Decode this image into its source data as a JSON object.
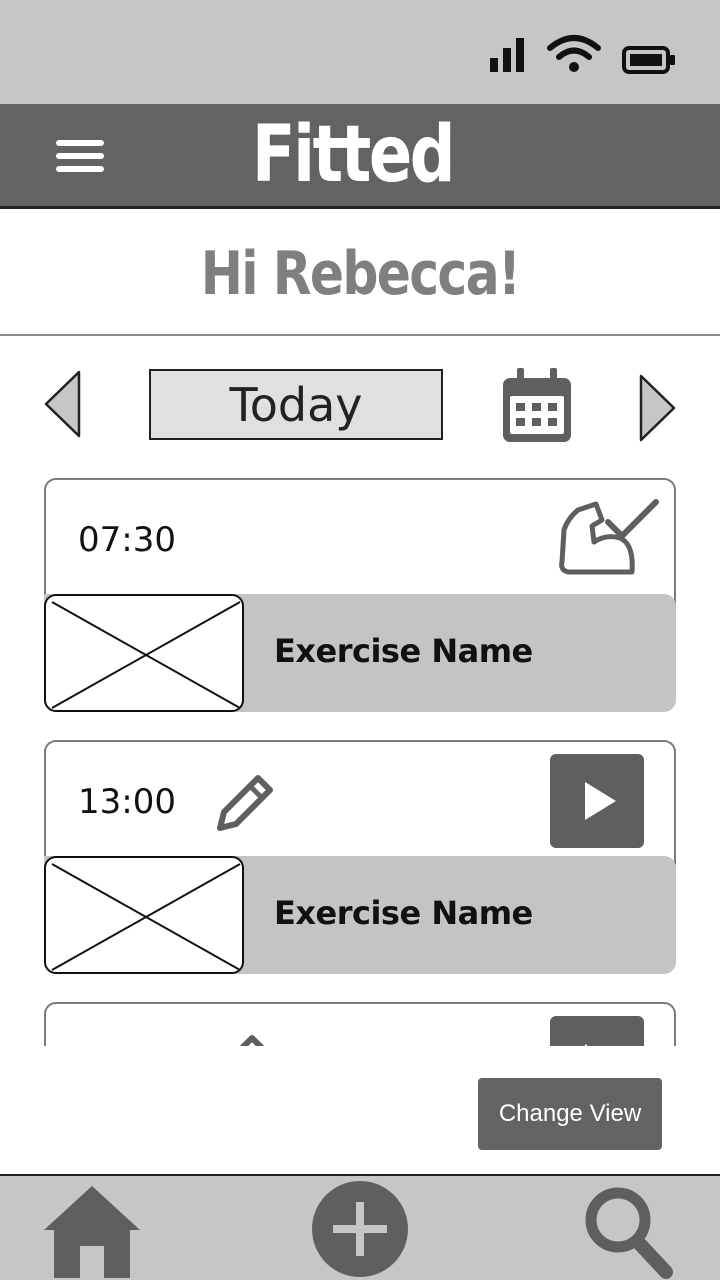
{
  "status_bar": {
    "icons": [
      "signal-icon",
      "wifi-icon",
      "battery-icon"
    ]
  },
  "app_bar": {
    "title": "Fitted",
    "menu_icon": "hamburger-menu-icon"
  },
  "greeting": "Hi Rebecca!",
  "date_nav": {
    "label": "Today",
    "prev_icon": "chevron-left-icon",
    "next_icon": "chevron-right-icon",
    "calendar_icon": "calendar-icon"
  },
  "workouts": [
    {
      "time": "07:30",
      "exercise": "Exercise Name",
      "status_icon": "flexed-arm-check-icon"
    },
    {
      "time": "13:00",
      "exercise": "Exercise Name",
      "actions": [
        "edit-icon",
        "play-icon"
      ]
    }
  ],
  "change_view_label": "Change View",
  "bottom_nav": [
    "home-icon",
    "add-icon",
    "search-icon"
  ],
  "colors": {
    "dark_gray": "#636363",
    "light_gray": "#c6c6c6",
    "greeting_gray": "#7f7f7f"
  }
}
